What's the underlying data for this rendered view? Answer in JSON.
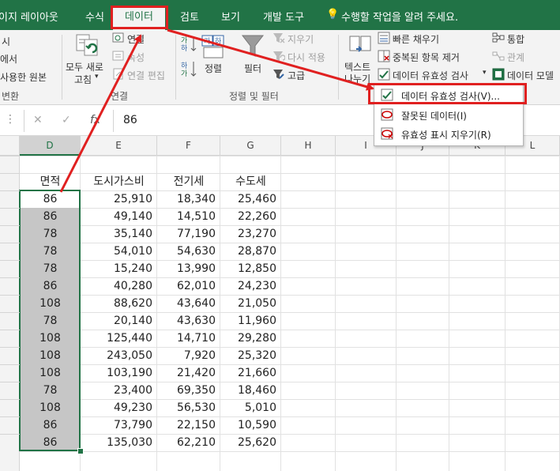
{
  "tabs": {
    "layout": "이지 레이아웃",
    "formulas": "수식",
    "data": "데이터",
    "review": "검토",
    "view": "보기",
    "developer": "개발 도구",
    "tell_me": "수행할 작업을 알려 주세요."
  },
  "ribbon": {
    "left_items": [
      "시",
      "에서",
      "사용한 원본",
      "변환"
    ],
    "queries": {
      "refresh_all_line1": "모두 새로",
      "refresh_all_line2": "고침",
      "connections": "연결",
      "properties": "속성",
      "edit_links": "연결 편집",
      "group_label": "연결"
    },
    "sort_filter": {
      "sort": "정렬",
      "filter": "필터",
      "clear": "지우기",
      "reapply": "다시 적용",
      "advanced": "고급",
      "group_label": "정렬 및 필터"
    },
    "data_tools": {
      "text_to_cols_line1": "텍스트",
      "text_to_cols_line2": "나누기",
      "flash_fill": "빠른 채우기",
      "remove_dup": "중복된 항목 제거",
      "validation": "데이터 유효성 검사",
      "consolidate": "통합",
      "relationships": "관계",
      "data_model": "데이터 모델"
    }
  },
  "dropdown": {
    "items": [
      "데이터 유효성 검사(V)...",
      "잘못된 데이터(I)",
      "유효성 표시 지우기(R)"
    ]
  },
  "formula_bar": {
    "cancel": "✕",
    "enter": "✓",
    "fx": "fx",
    "value": "86"
  },
  "columns": [
    "D",
    "E",
    "F",
    "G",
    "H",
    "I",
    "J",
    "K",
    "L"
  ],
  "table": {
    "headers": [
      "면적",
      "도시가스비",
      "전기세",
      "수도세"
    ],
    "rows": [
      [
        "86",
        "25,910",
        "18,340",
        "25,460"
      ],
      [
        "86",
        "49,140",
        "14,510",
        "22,260"
      ],
      [
        "78",
        "35,140",
        "77,190",
        "23,270"
      ],
      [
        "78",
        "54,010",
        "54,630",
        "28,870"
      ],
      [
        "78",
        "15,240",
        "13,990",
        "12,850"
      ],
      [
        "86",
        "40,280",
        "62,010",
        "24,230"
      ],
      [
        "108",
        "88,620",
        "43,640",
        "21,050"
      ],
      [
        "78",
        "20,140",
        "43,630",
        "11,960"
      ],
      [
        "108",
        "125,440",
        "14,710",
        "29,280"
      ],
      [
        "108",
        "243,050",
        "7,920",
        "25,320"
      ],
      [
        "108",
        "103,190",
        "21,420",
        "21,660"
      ],
      [
        "78",
        "23,400",
        "69,350",
        "18,460"
      ],
      [
        "108",
        "49,230",
        "56,530",
        "5,010"
      ],
      [
        "86",
        "73,790",
        "22,150",
        "10,590"
      ],
      [
        "86",
        "135,030",
        "62,210",
        "25,620"
      ]
    ]
  },
  "colors": {
    "excel_green": "#217346",
    "highlight_red": "#e02020",
    "selection_gray": "#c6c6c6"
  }
}
